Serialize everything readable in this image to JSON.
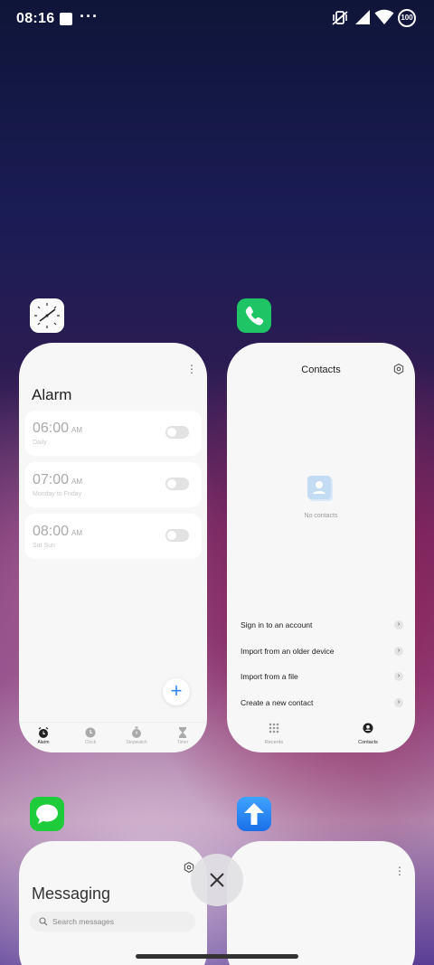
{
  "status_bar": {
    "time": "08:16",
    "battery": "100",
    "icons": [
      "screenshot-square-icon",
      "more-dots-icon",
      "vibrate-off-icon",
      "cell-signal-icon",
      "wifi-icon",
      "battery-icon"
    ]
  },
  "recents": {
    "clock": {
      "title": "Alarm",
      "alarms": [
        {
          "time": "06:00",
          "ampm": "AM",
          "repeat": "Daily",
          "enabled": false
        },
        {
          "time": "07:00",
          "ampm": "AM",
          "repeat": "Monday to Friday",
          "enabled": false
        },
        {
          "time": "08:00",
          "ampm": "AM",
          "repeat": "Sat Sun",
          "enabled": false
        }
      ],
      "nav": {
        "alarm": "Alarm",
        "clock": "Clock",
        "stopwatch": "Stopwatch",
        "timer": "Timer"
      }
    },
    "contacts": {
      "title": "Contacts",
      "empty_text": "No contacts",
      "actions": [
        "Sign in to an account",
        "Import from an older device",
        "Import from a file",
        "Create a new contact"
      ],
      "nav": {
        "recents": "Recents",
        "contacts": "Contacts"
      }
    },
    "messaging": {
      "title": "Messaging",
      "search_placeholder": "Search messages"
    }
  },
  "colors": {
    "phone_green": "#1fc564",
    "messages_green": "#1ecb3a",
    "accent_blue": "#2f86f6"
  }
}
